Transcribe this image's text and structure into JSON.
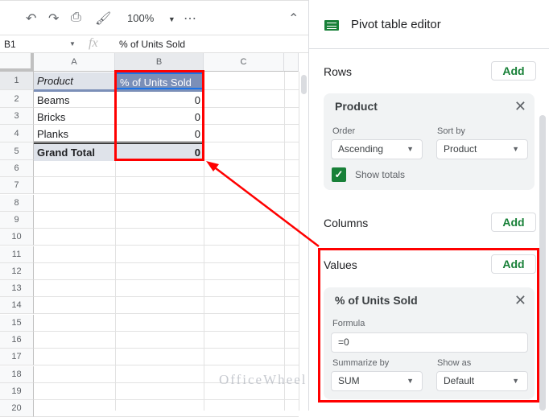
{
  "toolbar": {
    "zoom": "100%",
    "more": "⋯"
  },
  "formula_bar": {
    "cell_ref": "B1",
    "fx": "fx",
    "value": "% of Units Sold"
  },
  "columns": [
    "A",
    "B",
    "C"
  ],
  "rows": [
    "1",
    "2",
    "3",
    "4",
    "5",
    "6",
    "7",
    "8",
    "9",
    "10",
    "11",
    "12",
    "13",
    "14",
    "15",
    "16",
    "17",
    "18",
    "19",
    "20"
  ],
  "table": {
    "header": [
      "Product",
      "% of Units Sold"
    ],
    "data": [
      [
        "Beams",
        "0"
      ],
      [
        "Bricks",
        "0"
      ],
      [
        "Planks",
        "0"
      ]
    ],
    "total": [
      "Grand Total",
      "0"
    ]
  },
  "panel": {
    "title": "Pivot table editor",
    "rows_label": "Rows",
    "add": "Add",
    "row_card": {
      "title": "Product",
      "order_label": "Order",
      "order_value": "Ascending",
      "sortby_label": "Sort by",
      "sortby_value": "Product",
      "show_totals": "Show totals",
      "show_totals_checked": true
    },
    "columns_label": "Columns",
    "values_label": "Values",
    "value_card": {
      "title": "% of Units Sold",
      "formula_label": "Formula",
      "formula_value": "=0",
      "summarize_label": "Summarize by",
      "summarize_value": "SUM",
      "showas_label": "Show as",
      "showas_value": "Default"
    }
  },
  "watermark": "OfficeWheel",
  "colors": {
    "highlight": "#ff0000",
    "green": "#188038",
    "header_fill": "#7b8fb8"
  }
}
